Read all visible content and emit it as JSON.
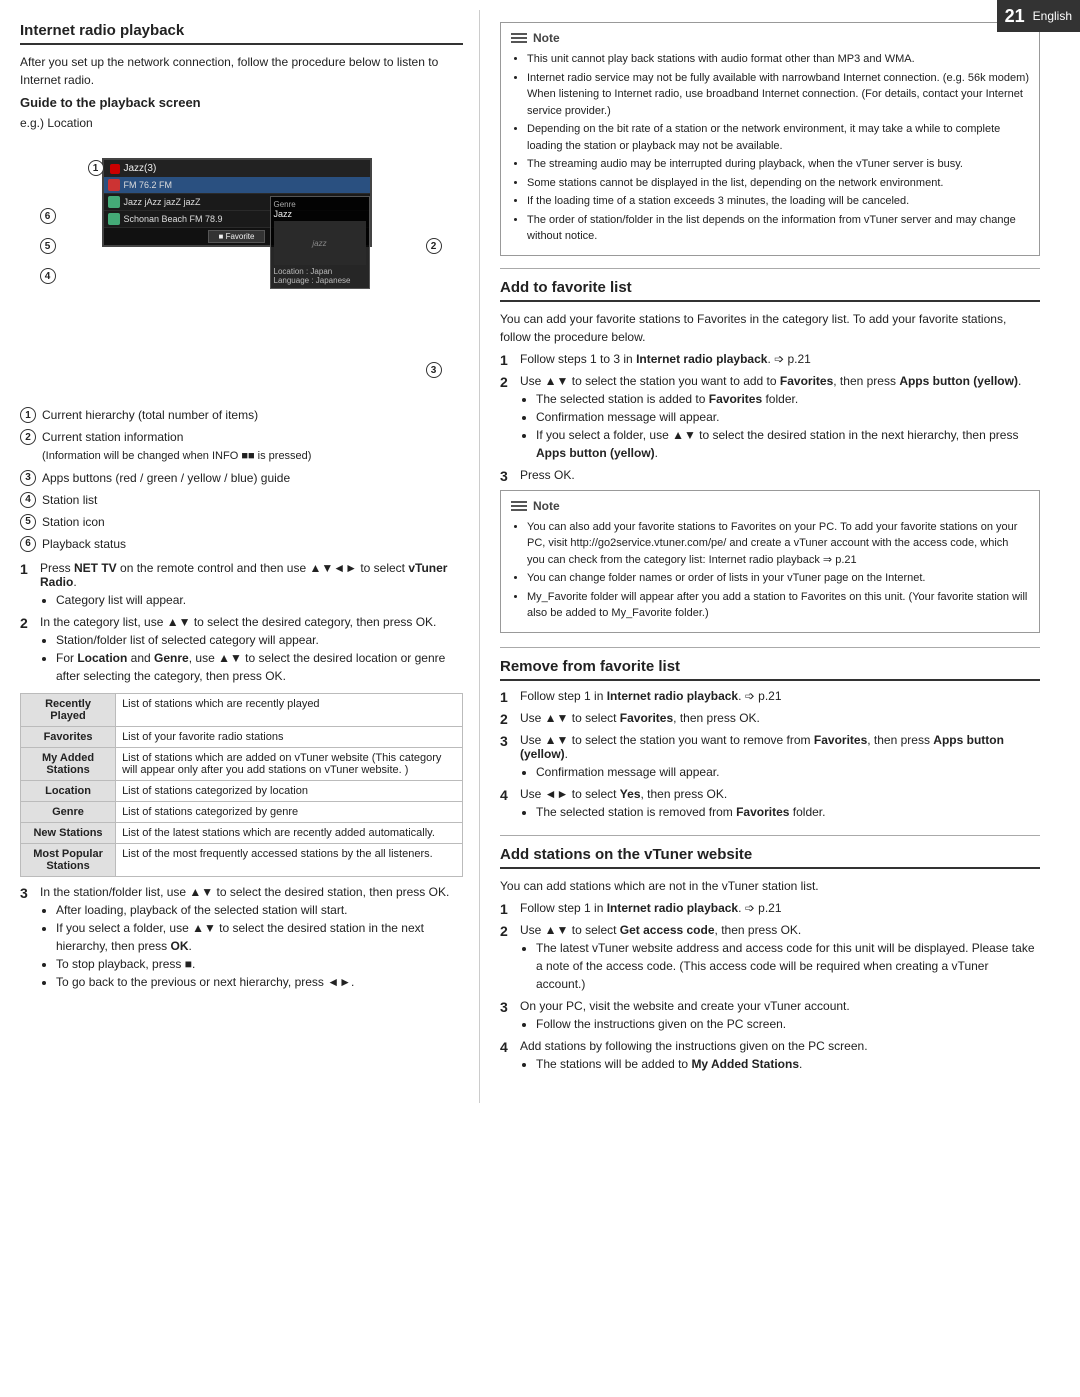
{
  "page": {
    "number": "21",
    "language": "English"
  },
  "left": {
    "main_title": "Internet radio playback",
    "intro": "After you set up the network connection, follow the procedure below to listen to Internet radio.",
    "guide_title": "Guide to the playback screen",
    "eg_location": "e.g.) Location",
    "diagram": {
      "station_name": "FM 76.2 FM",
      "list_items": [
        {
          "icon": "green",
          "text": "Jazz jAzz jazZ jazZ"
        },
        {
          "icon": "green",
          "text": "Schonan Beach FM 78.9",
          "selected": false
        }
      ],
      "top_text": "Jazz(3)",
      "genre_label": "Genre",
      "genre_value": "Jazz",
      "thumb_text": "jazz",
      "location_label": "Location",
      "location_value": "Japan",
      "language_label": "Language",
      "language_value": "Japanese",
      "fav_btn": "Favorite"
    },
    "callouts": [
      {
        "num": "1",
        "label": "Current hierarchy (total number of items)"
      },
      {
        "num": "2",
        "label": "Current station information"
      },
      {
        "num": "2",
        "sub": "(Information will be changed when INFO ■■ is pressed)"
      },
      {
        "num": "3",
        "label": "Apps buttons (red / green / yellow / blue) guide"
      },
      {
        "num": "4",
        "label": "Station list"
      },
      {
        "num": "5",
        "label": "Station icon"
      },
      {
        "num": "6",
        "label": "Playback status"
      }
    ],
    "steps": [
      {
        "num": "1",
        "text": "Press NET TV on the remote control and then use ▲▼◄► to select vTuner Radio.",
        "bullets": [
          "Category list will appear."
        ]
      },
      {
        "num": "2",
        "text": "In the category list, use ▲▼ to select the desired category, then press OK.",
        "bullets": [
          "Station/folder list of selected category will appear.",
          "For Location and Genre, use ▲▼ to select the desired location or genre after selecting the category, then press OK."
        ]
      }
    ],
    "category_table": {
      "headers": [
        "Recently Played",
        "Favorites",
        "My Added Stations",
        "Location",
        "Genre",
        "New Stations",
        "Most Popular Stations"
      ],
      "descriptions": [
        "List of stations which are recently played",
        "List of your favorite radio stations",
        "List of stations which are added on vTuner website (This category will appear only after you add stations on vTuner website.)",
        "List of stations categorized by location",
        "List of stations categorized by genre",
        "List of the latest stations which are recently added automatically.",
        "List of the most frequently accessed stations by the all listeners."
      ]
    },
    "steps2": [
      {
        "num": "3",
        "text": "In the station/folder list, use ▲▼ to select the desired station, then press OK.",
        "bullets": [
          "After loading, playback of the selected station will start.",
          "If you select a folder, use ▲▼ to select the desired station in the next hierarchy, then press OK.",
          "To stop playback, press ■.",
          "To go back to the previous or next hierarchy, press ◄►."
        ]
      }
    ]
  },
  "right": {
    "note1": {
      "label": "Note",
      "items": [
        "This unit cannot play back stations with audio format other than MP3 and WMA.",
        "Internet radio service may not be fully available with narrowband Internet connection. (e.g. 56k modem) When listening to Internet radio, use broadband Internet connection. (For details, contact your Internet service provider.)",
        "Depending on the bit rate of a station or the network environment, it may take a while to complete loading the station or playback may not be available.",
        "The streaming audio may be interrupted during playback, when the vTuner server is busy.",
        "Some stations cannot be displayed in the list, depending on the network environment.",
        "If the loading time of a station exceeds 3 minutes, the loading will be canceled.",
        "The order of station/folder in the list depends on the information from vTuner server and may change without notice."
      ]
    },
    "add_fav": {
      "title": "Add to favorite list",
      "intro": "You can add your favorite stations to Favorites in the category list. To add your favorite stations, follow the procedure below.",
      "steps": [
        {
          "num": "1",
          "text": "Follow steps 1 to 3 in Internet radio playback. ⇒ p.21"
        },
        {
          "num": "2",
          "text": "Use ▲▼ to select the station you want to add to Favorites, then press Apps button (yellow).",
          "bullets": [
            "The selected station is added to Favorites folder.",
            "Confirmation message will appear.",
            "If you select a folder, use ▲▼ to select the desired station in the next hierarchy, then press Apps button (yellow)."
          ]
        },
        {
          "num": "3",
          "text": "Press OK."
        }
      ]
    },
    "note2": {
      "label": "Note",
      "items": [
        "You can also add your favorite stations to Favorites on your PC. To add your favorite stations on your PC, visit http://go2service.vtuner.com/pe/ and create a vTuner account with the access code, which you can check from the category list: Internet radio playback ⇒ p.21",
        "You can change folder names or order of lists in your vTuner page on the Internet.",
        "My_Favorite folder will appear after you add a station to Favorites on this unit. (Your favorite station will also be added to My_Favorite folder.)"
      ]
    },
    "remove_fav": {
      "title": "Remove from favorite list",
      "steps": [
        {
          "num": "1",
          "text": "Follow step 1 in Internet radio playback. ⇒ p.21"
        },
        {
          "num": "2",
          "text": "Use ▲▼ to select Favorites, then press OK."
        },
        {
          "num": "3",
          "text": "Use ▲▼ to select the station you want to remove from Favorites, then press Apps button (yellow).",
          "bullets": [
            "Confirmation message will appear."
          ]
        },
        {
          "num": "4",
          "text": "Use ◄► to select Yes, then press OK.",
          "bullets": [
            "The selected station is removed from Favorites folder."
          ]
        }
      ]
    },
    "add_vtuner": {
      "title": "Add stations on the vTuner website",
      "intro": "You can add stations which are not in the vTuner station list.",
      "steps": [
        {
          "num": "1",
          "text": "Follow step 1 in Internet radio playback. ⇒ p.21"
        },
        {
          "num": "2",
          "text": "Use ▲▼ to select Get access code, then press OK.",
          "bullets": [
            "The latest vTuner website address and access code for this unit will be displayed. Please take a note of the access code. (This access code will be required when creating a vTuner account.)"
          ]
        },
        {
          "num": "3",
          "text": "On your PC, visit the website and create your vTuner account.",
          "bullets": [
            "Follow the instructions given on the PC screen."
          ]
        },
        {
          "num": "4",
          "text": "Add stations by following the instructions given on the PC screen.",
          "bullets": [
            "The stations will be added to My Added Stations."
          ]
        }
      ]
    }
  }
}
